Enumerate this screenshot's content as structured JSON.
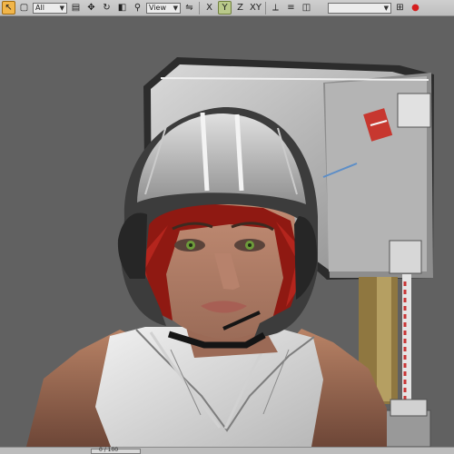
{
  "toolbar": {
    "filter_value": "All",
    "view_value": "View",
    "named_selection_value": "",
    "buttons": [
      {
        "name": "select-object-icon",
        "glyph": "↖"
      },
      {
        "name": "select-region-icon",
        "glyph": "▢"
      },
      {
        "name": "select-by-name-icon",
        "glyph": "▤"
      },
      {
        "name": "move-icon",
        "glyph": "✥"
      },
      {
        "name": "rotate-icon",
        "glyph": "↻"
      },
      {
        "name": "scale-icon",
        "glyph": "◧"
      },
      {
        "name": "snap-icon",
        "glyph": "⚲"
      },
      {
        "name": "mirror-icon",
        "glyph": "⇋"
      },
      {
        "name": "axis-x-label",
        "glyph": "X"
      },
      {
        "name": "axis-y-label",
        "glyph": "Y"
      },
      {
        "name": "axis-z-label",
        "glyph": "Z"
      },
      {
        "name": "axis-xy-label",
        "glyph": "XY"
      },
      {
        "name": "align-icon",
        "glyph": "⟂"
      },
      {
        "name": "layers-icon",
        "glyph": "≡"
      },
      {
        "name": "curve-editor-icon",
        "glyph": "◫"
      },
      {
        "name": "schematic-icon",
        "glyph": "⊞"
      },
      {
        "name": "render-icon",
        "glyph": "●"
      }
    ]
  },
  "status": {
    "time_slider": "0 / 100"
  },
  "colors": {
    "accent_active": "#f2b64a",
    "accent_on": "#b9c98a",
    "viewport_bg": "#616161",
    "toolbar_bg": "#c6c6c6"
  }
}
